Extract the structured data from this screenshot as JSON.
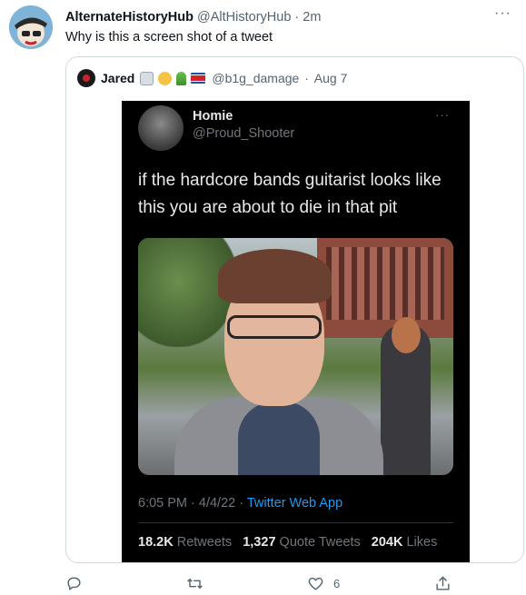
{
  "tweet": {
    "author_name": "AlternateHistoryHub",
    "author_handle": "@AltHistoryHub",
    "time": "2m",
    "text": "Why is this a screen shot of a tweet"
  },
  "quoted": {
    "author_name": "Jared",
    "author_handle": "@b1g_damage",
    "date": "Aug 7",
    "screenshot": {
      "name": "Homie",
      "handle": "@Proud_Shooter",
      "text": "if the hardcore bands guitarist looks like this you are about to die in that pit",
      "time": "6:05 PM · 4/4/22 · ",
      "source": "Twitter Web App",
      "retweets_count": "18.2K",
      "retweets_label": "Retweets",
      "quotes_count": "1,327",
      "quotes_label": "Quote Tweets",
      "likes_count": "204K",
      "likes_label": "Likes"
    }
  },
  "actions": {
    "reply_count": "",
    "retweet_count": "",
    "like_count": "6",
    "share_count": ""
  },
  "colors": {
    "accent": "#1d9bf0",
    "text": "#0f1419",
    "muted": "#536471"
  }
}
